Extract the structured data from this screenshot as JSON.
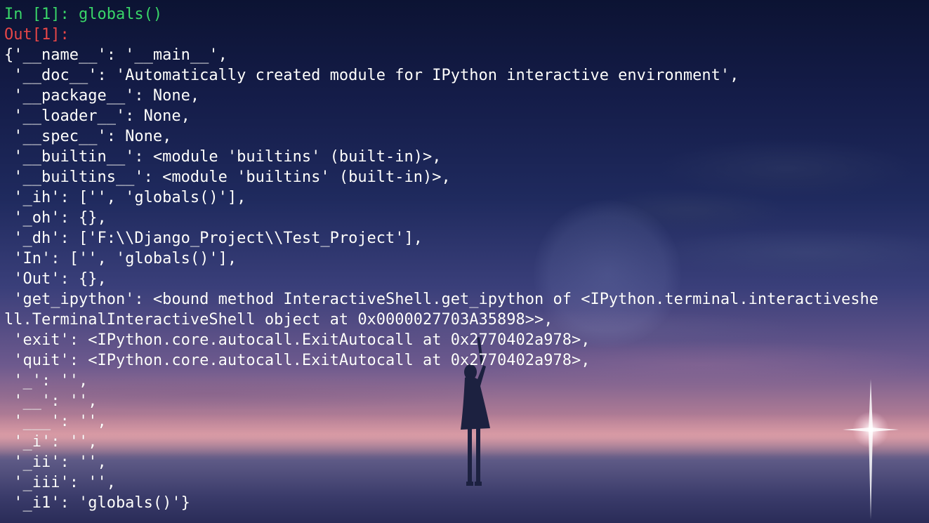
{
  "colors": {
    "prompt_in": "#3ad66b",
    "prompt_out": "#e8474a",
    "text": "#ffffff"
  },
  "session": {
    "input_prompt": "In [1]:",
    "input_command": " globals()",
    "output_prompt": "Out[1]:"
  },
  "output_lines": [
    "{'__name__': '__main__',",
    " '__doc__': 'Automatically created module for IPython interactive environment',",
    " '__package__': None,",
    " '__loader__': None,",
    " '__spec__': None,",
    " '__builtin__': <module 'builtins' (built-in)>,",
    " '__builtins__': <module 'builtins' (built-in)>,",
    " '_ih': ['', 'globals()'],",
    " '_oh': {},",
    " '_dh': ['F:\\\\Django_Project\\\\Test_Project'],",
    " 'In': ['', 'globals()'],",
    " 'Out': {},",
    " 'get_ipython': <bound method InteractiveShell.get_ipython of <IPython.terminal.interactiveshe",
    "ll.TerminalInteractiveShell object at 0x0000027703A35898>>,",
    " 'exit': <IPython.core.autocall.ExitAutocall at 0x2770402a978>,",
    " 'quit': <IPython.core.autocall.ExitAutocall at 0x2770402a978>,",
    " '_': '',",
    " '__': '',",
    " '___': '',",
    " '_i': '',",
    " '_ii': '',",
    " '_iii': '',",
    " '_i1': 'globals()'}"
  ]
}
